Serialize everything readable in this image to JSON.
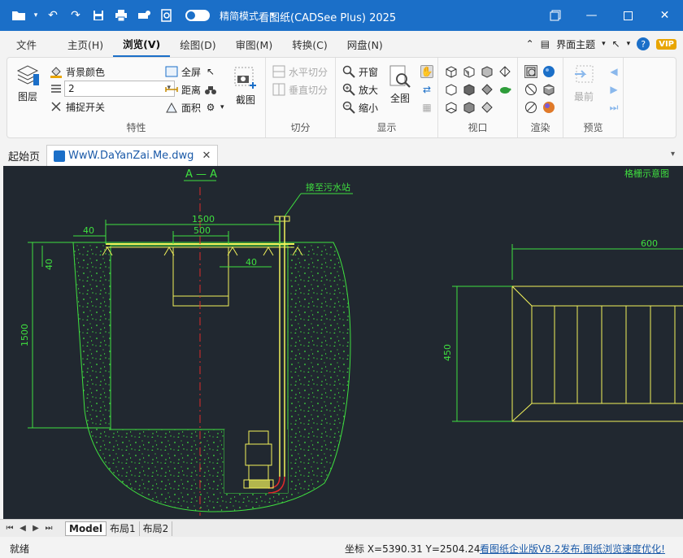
{
  "titlebar": {
    "mode_label": "精简模式",
    "title": "看图纸(CADSee Plus) 2025"
  },
  "menu": {
    "tabs": [
      {
        "label": "文件"
      },
      {
        "label": "主页(H)"
      },
      {
        "label": "浏览(V)"
      },
      {
        "label": "绘图(D)"
      },
      {
        "label": "审图(M)"
      },
      {
        "label": "转换(C)"
      },
      {
        "label": "网盘(N)"
      }
    ],
    "theme_label": "界面主题",
    "vip_label": "VIP"
  },
  "ribbon": {
    "props": {
      "layer_label": "图层",
      "bg_color_label": "背景颜色",
      "combo_value": "2",
      "snap_label": "捕捉开关",
      "fullscreen_label": "全屏",
      "distance_label": "距离",
      "area_label": "面积",
      "screenshot_label": "截图",
      "group_label": "特性"
    },
    "split": {
      "hsplit_label": "水平切分",
      "vsplit_label": "垂直切分",
      "group_label": "切分"
    },
    "display": {
      "open_window_label": "开窗",
      "zoom_in_label": "放大",
      "zoom_out_label": "缩小",
      "full_view_label": "全图",
      "group_label": "显示"
    },
    "viewport": {
      "group_label": "视口"
    },
    "render": {
      "group_label": "渲染"
    },
    "preview": {
      "recent_label": "最前",
      "group_label": "预览"
    }
  },
  "doc_tabs": {
    "start_label": "起始页",
    "file_label": "WwW.DaYanZai.Me.dwg"
  },
  "drawing": {
    "section_title": "A — A",
    "right_title": "格栅示意图",
    "note": "接至污水站",
    "dims": {
      "d1500_top": "1500",
      "d500": "500",
      "d40_left": "40",
      "d40_side": "40",
      "d40_mid": "40",
      "d1500_side": "1500",
      "d600": "600",
      "d450": "450"
    }
  },
  "layout_tabs": [
    {
      "label": "Model"
    },
    {
      "label": "布局1"
    },
    {
      "label": "布局2"
    }
  ],
  "status": {
    "ready": "就绪",
    "coords": "坐标 X=5390.31 Y=2504.24",
    "promo": "看图纸企业版V8.2发布,图纸浏览速度优化!"
  },
  "colors": {
    "titlebar": "#1b6fc8",
    "canvas": "#212830",
    "cad_green": "#3fe03f",
    "cad_yellow": "#f2f25a",
    "cad_red": "#e02a2a"
  }
}
